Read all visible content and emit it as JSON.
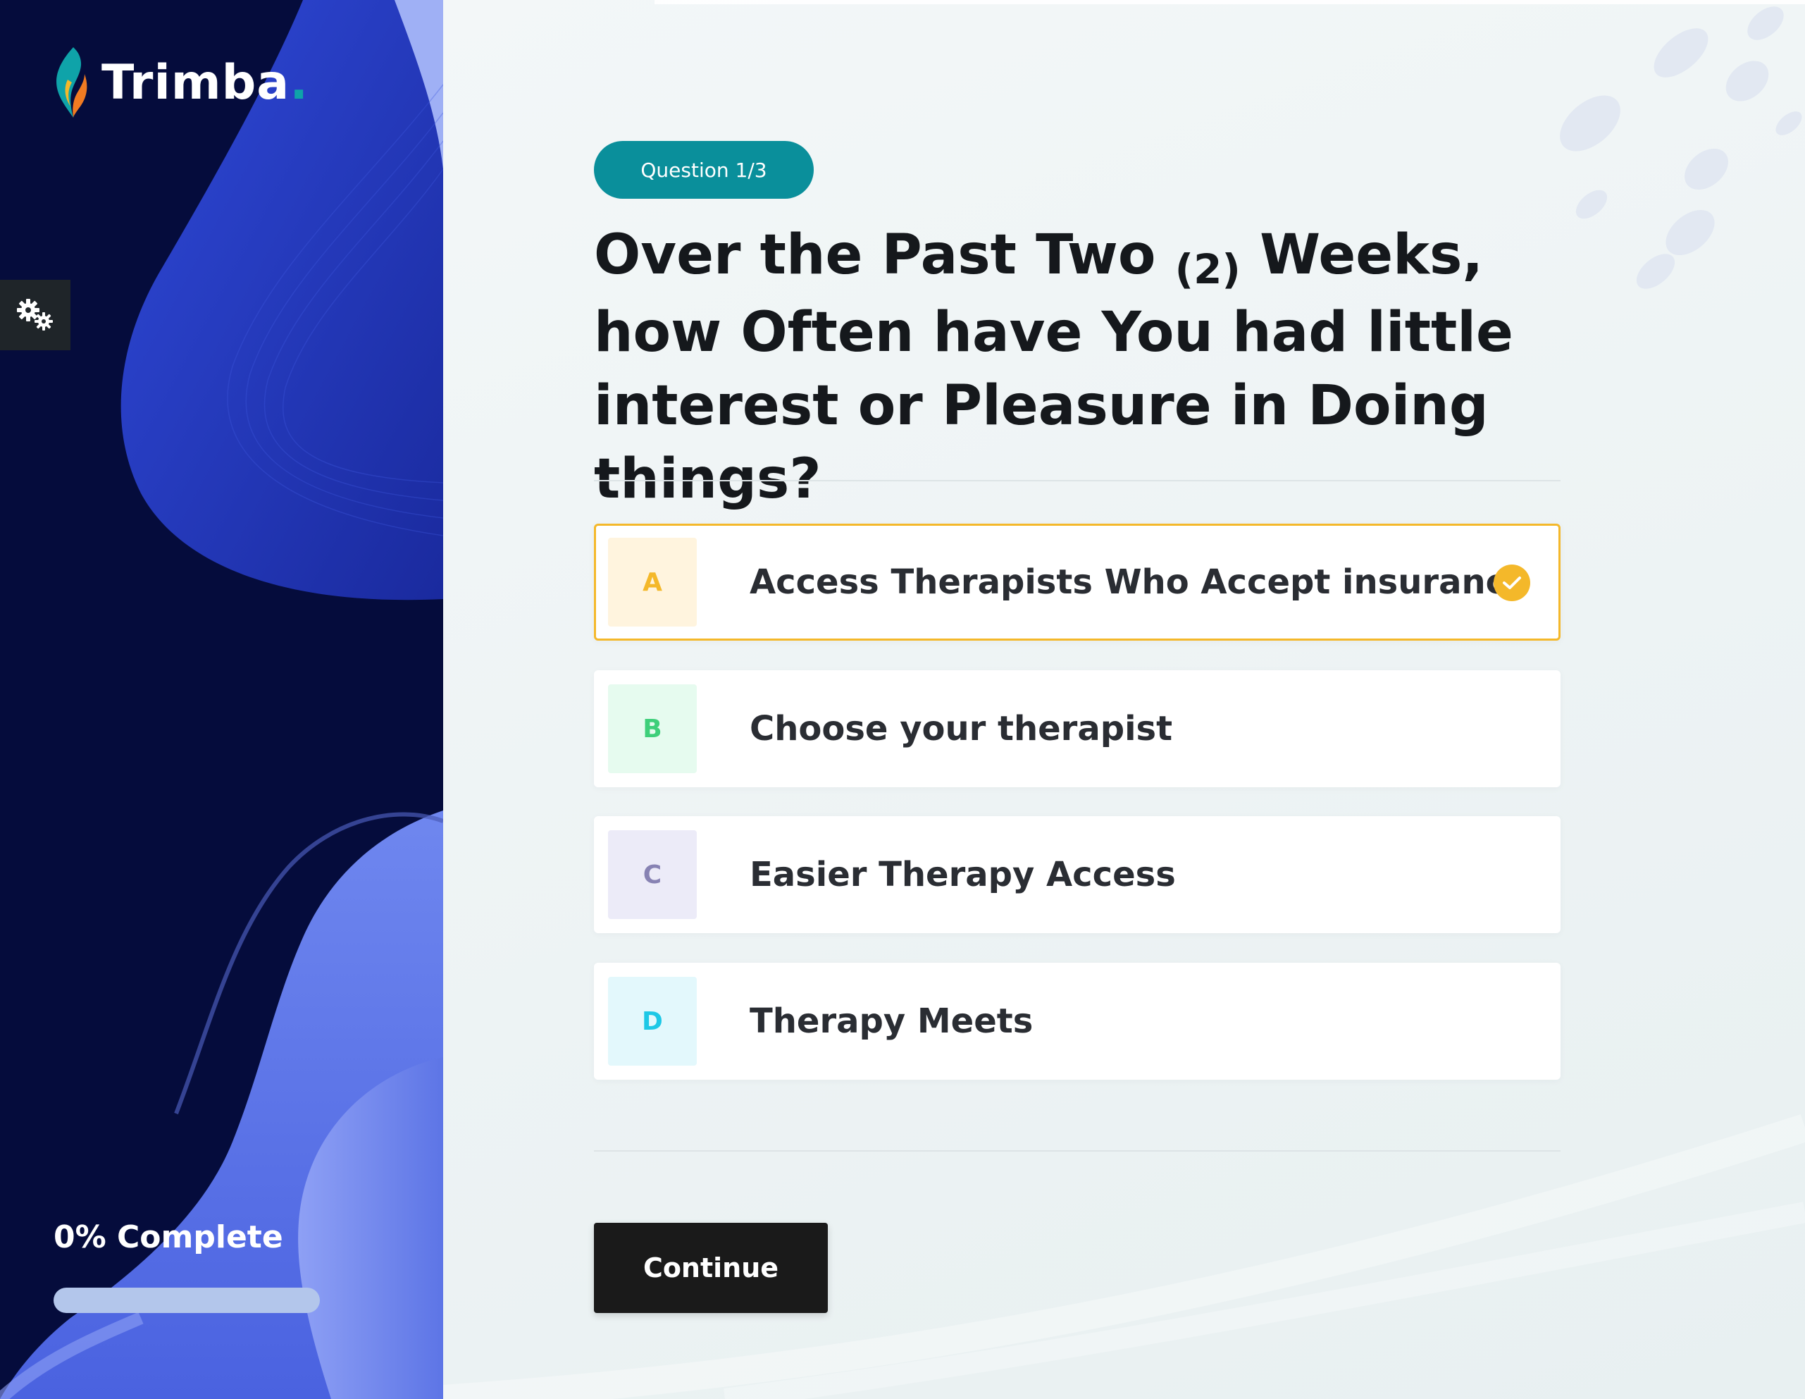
{
  "brand": {
    "name": "Trimba",
    "dot": ".",
    "accent_color": "#0fa3a9"
  },
  "sidebar": {
    "settings_icon": "gears-icon",
    "progress": {
      "label": "0% Complete",
      "percent": 0
    }
  },
  "question": {
    "badge": "Question 1/3",
    "text_before": "Over the Past Two ",
    "text_number": "(2)",
    "text_after": " Weeks, how Often have You had little interest or Pleasure in Doing things?"
  },
  "options": [
    {
      "letter": "A",
      "label": "Access Therapists Who Accept insurance",
      "selected": true,
      "letter_color": "#f4b82a",
      "letter_bg": "#fff4de"
    },
    {
      "letter": "B",
      "label": "Choose your therapist",
      "selected": false,
      "letter_color": "#3ecf7a",
      "letter_bg": "#e6fbef"
    },
    {
      "letter": "C",
      "label": "Easier Therapy Access",
      "selected": false,
      "letter_color": "#8782b3",
      "letter_bg": "#ecebf8"
    },
    {
      "letter": "D",
      "label": "Therapy Meets",
      "selected": false,
      "letter_color": "#1ec8e6",
      "letter_bg": "#e3f8fc"
    }
  ],
  "actions": {
    "continue_label": "Continue"
  },
  "colors": {
    "selected_border": "#f4b82a",
    "badge_bg": "#0a8f9b",
    "sidebar_bg": "#050c3c",
    "button_bg": "#1a1a1a"
  }
}
